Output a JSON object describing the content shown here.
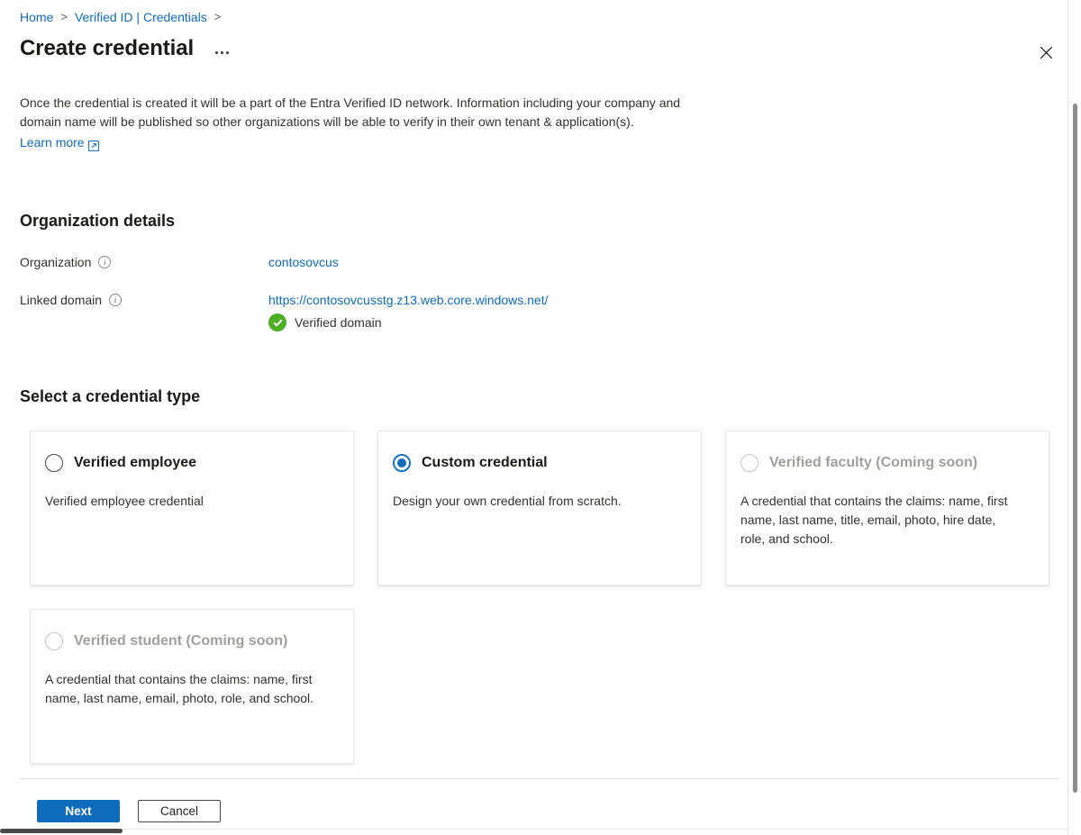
{
  "breadcrumb": {
    "items": [
      {
        "label": "Home",
        "separator": ">"
      },
      {
        "label": "Verified ID | Credentials",
        "separator": ">"
      }
    ],
    "sep1": ">",
    "sep2": ">"
  },
  "header": {
    "title": "Create credential",
    "more_label": "...",
    "close_label": "Close"
  },
  "intro": {
    "paragraph": "Once the credential is created it will be a part of the Entra Verified ID network. Information including your company and domain name will be published so other organizations will be able to verify in their own tenant & application(s).",
    "learn_more": "Learn more"
  },
  "organization_section": {
    "heading": "Organization details",
    "rows": [
      {
        "label": "Organization",
        "info": "i",
        "value": "contosovcus"
      },
      {
        "label": "Linked domain",
        "info": "i",
        "value": "https://contosovcusstg.z13.web.core.windows.net/",
        "status": "Verified domain"
      }
    ]
  },
  "credential_section": {
    "heading": "Select a credential type",
    "cards": [
      {
        "title": "Verified employee",
        "description": "Verified employee credential",
        "selected": false,
        "disabled": false
      },
      {
        "title": "Custom credential",
        "description": "Design your own credential from scratch.",
        "selected": true,
        "disabled": false
      },
      {
        "title": "Verified faculty (Coming soon)",
        "description": "A credential that contains the claims: name, first name, last name, title, email, photo, hire date, role, and school.",
        "selected": false,
        "disabled": true
      },
      {
        "title": "Verified student (Coming soon)",
        "description": "A credential that contains the claims: name, first name, last name, email, photo, role, and school.",
        "selected": false,
        "disabled": true
      }
    ]
  },
  "footer": {
    "next_label": "Next",
    "cancel_label": "Cancel"
  },
  "colors": {
    "accent_blue": "#0f6cbd",
    "link_blue": "#0f6cbd",
    "verified_green": "#4caf26",
    "muted_text": "#a19f9d",
    "body_text": "#323130"
  }
}
